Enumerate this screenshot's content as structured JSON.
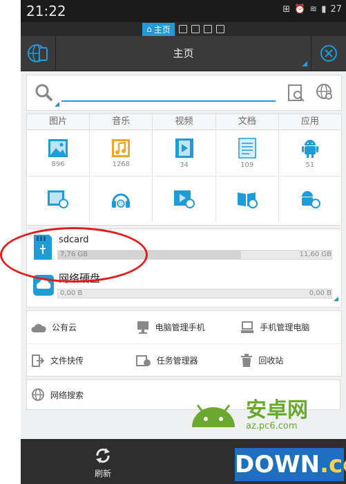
{
  "status": {
    "time": "21:22",
    "battery": "27"
  },
  "tabs": {
    "home_label": "主页"
  },
  "header": {
    "title": "主页"
  },
  "categories": {
    "labels": [
      "图片",
      "音乐",
      "视频",
      "文档",
      "应用"
    ],
    "counts": [
      "896",
      "1268",
      "34",
      "109",
      "51"
    ]
  },
  "storage": {
    "sdcard": {
      "name": "sdcard",
      "used": "7,76 GB",
      "total": "11,60 GB",
      "fill_percent": 67
    },
    "netdisk": {
      "name": "网络硬盘",
      "used": "0,00 B",
      "total": "0,00 B"
    }
  },
  "tools": {
    "items": [
      "公有云",
      "电脑管理手机",
      "手机管理电脑",
      "文件快传",
      "任务管理器",
      "回收站"
    ]
  },
  "netsearch": {
    "label": "网络搜索"
  },
  "bottom": {
    "refresh_label": "刷新"
  },
  "watermarks": {
    "site_name": "安卓网",
    "site_url": "az.pc6.com",
    "brand": "DOWN",
    "brand_suffix": ".cc"
  },
  "colors": {
    "accent": "#1f9bd6",
    "annotation": "#e21b1b"
  }
}
